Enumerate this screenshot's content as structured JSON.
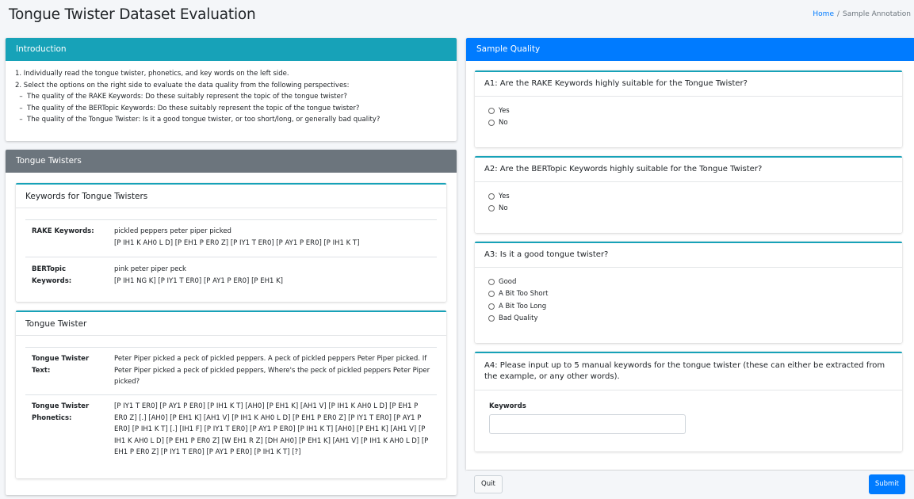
{
  "header": {
    "title": "Tongue Twister Dataset Evaluation",
    "breadcrumb": {
      "home": "Home",
      "separator": "/",
      "current": "Sample Annotation"
    }
  },
  "intro": {
    "title": "Introduction",
    "lines": [
      "1. Individually read the tongue twister, phonetics, and key words on the left side.",
      "2. Select the options on the right side to evaluate the data quality from the following perspectives:",
      "  –  The quality of the RAKE Keywords: Do these suitably represent the topic of the tongue twister?",
      "  –  The quality of the BERTopic Keywords: Do these suitably represent the topic of the tongue twister?",
      "  –  The quality of the Tongue Twister: Is it a good tongue twister, or too short/long, or generally bad quality?"
    ]
  },
  "twisters": {
    "title": "Tongue Twisters",
    "keywords_card": {
      "title": "Keywords for Tongue Twisters",
      "rake": {
        "label": "RAKE Keywords:",
        "words": "pickled peppers peter piper picked",
        "phonetics": "[P IH1 K AH0 L D] [P EH1 P ER0 Z] [P IY1 T ER0] [P AY1 P ER0] [P IH1 K T]"
      },
      "bertopic": {
        "label": "BERTopic Keywords:",
        "words": "pink peter piper peck",
        "phonetics": "[P IH1 NG K] [P IY1 T ER0] [P AY1 P ER0] [P EH1 K]"
      }
    },
    "twister_card": {
      "title": "Tongue Twister",
      "text_label": "Tongue Twister Text:",
      "text": "Peter Piper picked a peck of pickled peppers. A peck of pickled peppers Peter Piper picked. If Peter Piper picked a peck of pickled peppers, Where's the peck of pickled peppers Peter Piper picked?",
      "phonetics_label": "Tongue Twister Phonetics:",
      "phonetics": "[P IY1 T ER0] [P AY1 P ER0] [P IH1 K T] [AH0] [P EH1 K] [AH1 V] [P IH1 K AH0 L D] [P EH1 P ER0 Z] [.] [AH0] [P EH1 K] [AH1 V] [P IH1 K AH0 L D] [P EH1 P ER0 Z] [P IY1 T ER0] [P AY1 P ER0] [P IH1 K T] [.] [IH1 F] [P IY1 T ER0] [P AY1 P ER0] [P IH1 K T] [AH0] [P EH1 K] [AH1 V] [P IH1 K AH0 L D] [P EH1 P ER0 Z] [W EH1 R Z] [DH AH0] [P EH1 K] [AH1 V] [P IH1 K AH0 L D] [P EH1 P ER0 Z] [P IY1 T ER0] [P AY1 P ER0] [P IH1 K T] [?]"
    }
  },
  "quality": {
    "title": "Sample Quality",
    "q1": {
      "question": "A1: Are the RAKE Keywords highly suitable for the Tongue Twister?",
      "options": [
        "Yes",
        "No"
      ]
    },
    "q2": {
      "question": "A2: Are the BERTopic Keywords highly suitable for the Tongue Twister?",
      "options": [
        "Yes",
        "No"
      ]
    },
    "q3": {
      "question": "A3: Is it a good tongue twister?",
      "options": [
        "Good",
        "A Bit Too Short",
        "A Bit Too Long",
        "Bad Quality"
      ]
    },
    "q4": {
      "question": "A4: Please input up to 5 manual keywords for the tongue twister (these can either be extracted from the example, or any other words).",
      "field_label": "Keywords",
      "value": ""
    }
  },
  "footer": {
    "quit": "Quit",
    "submit": "Submit"
  }
}
